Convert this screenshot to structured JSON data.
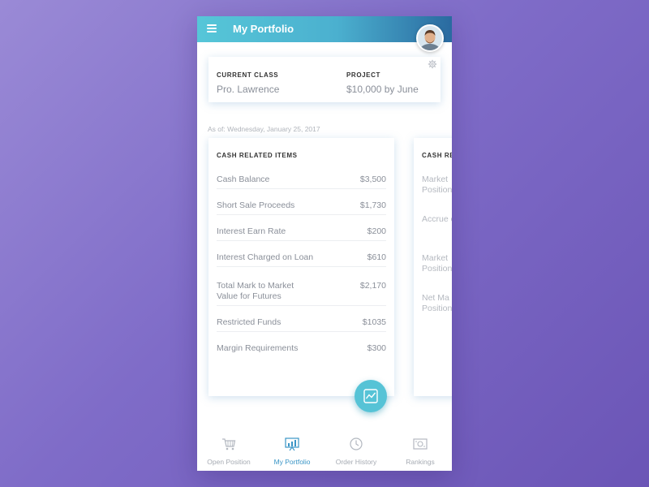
{
  "header": {
    "title": "My Portfolio",
    "menu_icon": "hamburger-menu-icon",
    "avatar": "user-avatar"
  },
  "summary": {
    "current_class_label": "CURRENT CLASS",
    "current_class_value": "Pro. Lawrence",
    "project_label": "PROJECT",
    "project_value": "$10,000 by June",
    "settings_icon": "gear-icon"
  },
  "as_of": "As of: Wednesday, January 25, 2017",
  "cash_card": {
    "title": "CASH RELATED ITEMS",
    "rows": [
      {
        "label": "Cash Balance",
        "value": "$3,500"
      },
      {
        "label": "Short Sale Proceeds",
        "value": "$1,730"
      },
      {
        "label": "Interest Earn Rate",
        "value": "$200"
      },
      {
        "label": "Interest Charged on Loan",
        "value": "$610"
      },
      {
        "label": "Total Mark to Market Value for Futures",
        "value": "$2,170"
      },
      {
        "label": "Restricted Funds",
        "value": "$1035"
      },
      {
        "label": "Margin Requirements",
        "value": "$300"
      }
    ]
  },
  "peek_card": {
    "title": "CASH RE",
    "items": [
      "Market Position",
      "Accrue on Bon",
      "Market Position",
      "Net Ma Position"
    ]
  },
  "fab_icon": "chart-icon",
  "tabs": [
    {
      "label": "Open Position",
      "icon": "cart-icon",
      "active": false
    },
    {
      "label": "My Portfolio",
      "icon": "portfolio-chart-icon",
      "active": true
    },
    {
      "label": "Order History",
      "icon": "clock-icon",
      "active": false
    },
    {
      "label": "Rankings",
      "icon": "rankings-icon",
      "active": false
    }
  ],
  "colors": {
    "accent": "#56c3d6",
    "active_tab": "#3a95c6",
    "muted_text": "#8a8f99"
  }
}
